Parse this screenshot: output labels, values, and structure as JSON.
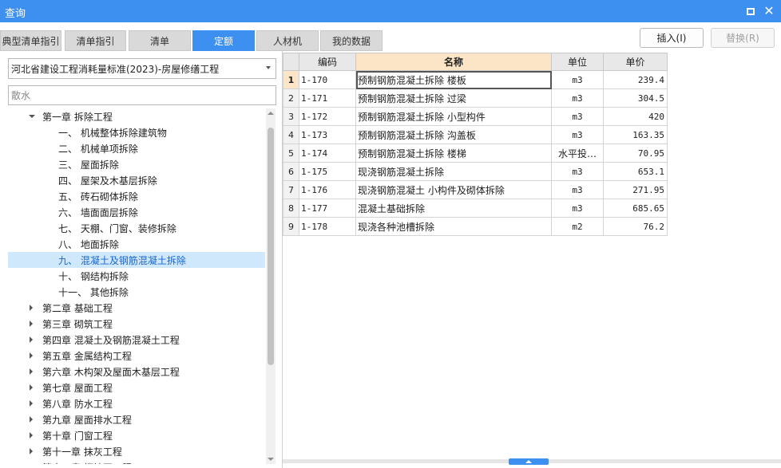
{
  "window": {
    "title": "查询",
    "maximize_icon": "maximize-icon",
    "close_icon": "close-icon",
    "close_glyph": "✕",
    "accent_color": "#3d8ff0"
  },
  "tabs": [
    {
      "label": "典型清单指引",
      "active": false
    },
    {
      "label": "清单指引",
      "active": false
    },
    {
      "label": "清单",
      "active": false
    },
    {
      "label": "定额",
      "active": true
    },
    {
      "label": "人材机",
      "active": false
    },
    {
      "label": "我的数据",
      "active": false
    }
  ],
  "actions": {
    "insert_label": "插入(I)",
    "replace_label": "替换(R)"
  },
  "library": {
    "selected": "河北省建设工程消耗量标准(2023)-房屋修缮工程"
  },
  "search": {
    "value": "散水"
  },
  "tree": [
    {
      "label": "第一章 拆除工程",
      "level": 1,
      "expanded": true,
      "selected": false
    },
    {
      "label": "一、 机械整体拆除建筑物",
      "level": 2,
      "selected": false
    },
    {
      "label": "二、 机械单项拆除",
      "level": 2,
      "selected": false
    },
    {
      "label": "三、 屋面拆除",
      "level": 2,
      "selected": false
    },
    {
      "label": "四、 屋架及木基层拆除",
      "level": 2,
      "selected": false
    },
    {
      "label": "五、 砖石砌体拆除",
      "level": 2,
      "selected": false
    },
    {
      "label": "六、 墙面面层拆除",
      "level": 2,
      "selected": false
    },
    {
      "label": "七、 天棚、门窗、装修拆除",
      "level": 2,
      "selected": false
    },
    {
      "label": "八、 地面拆除",
      "level": 2,
      "selected": false
    },
    {
      "label": "九、 混凝土及钢筋混凝土拆除",
      "level": 2,
      "selected": true
    },
    {
      "label": "十、 钢结构拆除",
      "level": 2,
      "selected": false
    },
    {
      "label": "十一、 其他拆除",
      "level": 2,
      "selected": false
    },
    {
      "label": "第二章 基础工程",
      "level": 1,
      "expanded": false,
      "selected": false
    },
    {
      "label": "第三章 砌筑工程",
      "level": 1,
      "expanded": false,
      "selected": false
    },
    {
      "label": "第四章 混凝土及钢筋混凝土工程",
      "level": 1,
      "expanded": false,
      "selected": false
    },
    {
      "label": "第五章 金属结构工程",
      "level": 1,
      "expanded": false,
      "selected": false
    },
    {
      "label": "第六章 木构架及屋面木基层工程",
      "level": 1,
      "expanded": false,
      "selected": false
    },
    {
      "label": "第七章 屋面工程",
      "level": 1,
      "expanded": false,
      "selected": false
    },
    {
      "label": "第八章 防水工程",
      "level": 1,
      "expanded": false,
      "selected": false
    },
    {
      "label": "第九章 屋面排水工程",
      "level": 1,
      "expanded": false,
      "selected": false
    },
    {
      "label": "第十章 门窗工程",
      "level": 1,
      "expanded": false,
      "selected": false
    },
    {
      "label": "第十一章 抹灰工程",
      "level": 1,
      "expanded": false,
      "selected": false
    },
    {
      "label": "第十二章 楼地面工程",
      "level": 1,
      "expanded": false,
      "selected": false
    }
  ],
  "table": {
    "headers": {
      "code": "编码",
      "name": "名称",
      "unit": "单位",
      "price": "单价"
    },
    "rows": [
      {
        "no": "1",
        "code": "1-170",
        "name": "预制钢筋混凝土拆除 楼板",
        "unit": "m3",
        "price": "239.4"
      },
      {
        "no": "2",
        "code": "1-171",
        "name": "预制钢筋混凝土拆除 过梁",
        "unit": "m3",
        "price": "304.5"
      },
      {
        "no": "3",
        "code": "1-172",
        "name": "预制钢筋混凝土拆除 小型构件",
        "unit": "m3",
        "price": "420"
      },
      {
        "no": "4",
        "code": "1-173",
        "name": "预制钢筋混凝土拆除 沟盖板",
        "unit": "m3",
        "price": "163.35"
      },
      {
        "no": "5",
        "code": "1-174",
        "name": "预制钢筋混凝土拆除 楼梯",
        "unit": "水平投…",
        "price": "70.95"
      },
      {
        "no": "6",
        "code": "1-175",
        "name": "现浇钢筋混凝土拆除",
        "unit": "m3",
        "price": "653.1"
      },
      {
        "no": "7",
        "code": "1-176",
        "name": "现浇钢筋混凝土 小构件及砌体拆除",
        "unit": "m3",
        "price": "271.95"
      },
      {
        "no": "8",
        "code": "1-177",
        "name": "混凝土基础拆除",
        "unit": "m3",
        "price": "685.65"
      },
      {
        "no": "9",
        "code": "1-178",
        "name": "现浇各种池槽拆除",
        "unit": "m2",
        "price": "76.2"
      }
    ]
  }
}
